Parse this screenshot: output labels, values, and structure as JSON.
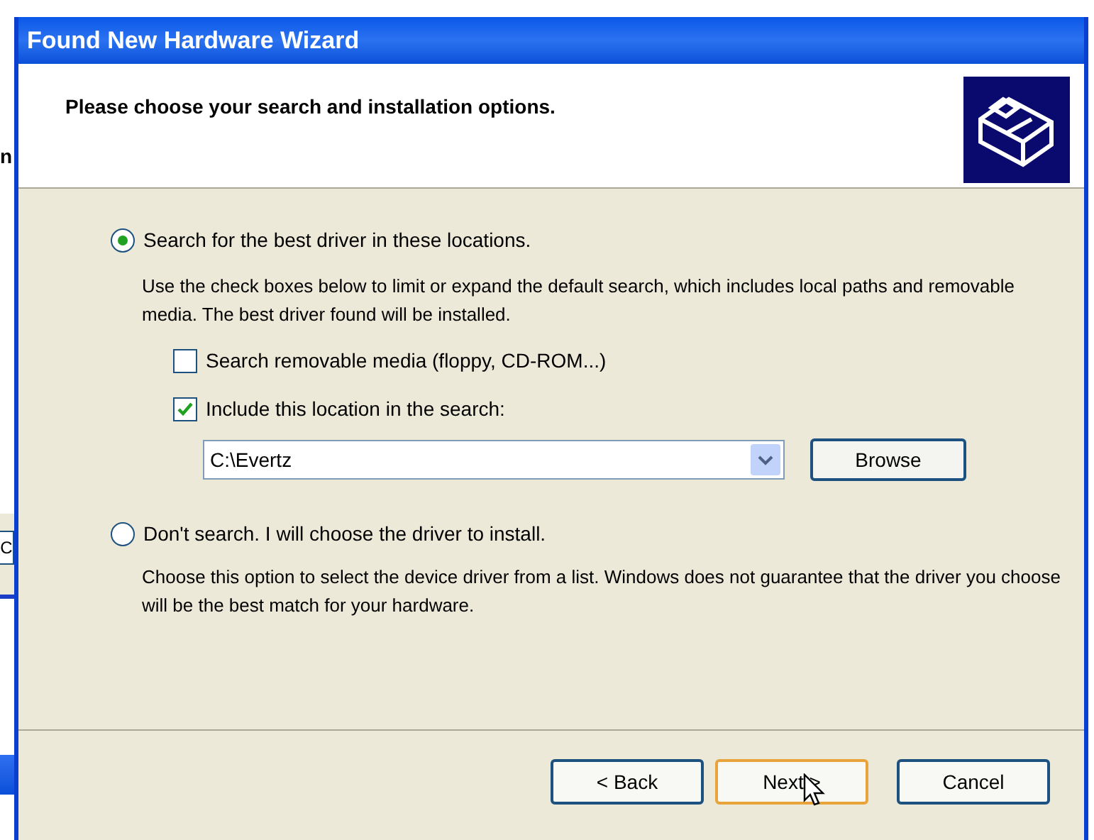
{
  "background": {
    "fragment_text": "n",
    "button_fragment": "C"
  },
  "window": {
    "title": "Found New Hardware Wizard"
  },
  "header": {
    "title": "Please choose your search and installation options."
  },
  "options": [
    {
      "label": "Search for the best driver in these locations.",
      "selected": true,
      "description": "Use the check boxes below to limit or expand the default search, which includes local paths and removable media. The best driver found will be installed."
    },
    {
      "label": "Don't search. I will choose the driver to install.",
      "selected": false,
      "description": "Choose this option to select the device driver from a list.  Windows does not guarantee that the driver you choose will be the best match for your hardware."
    }
  ],
  "checkboxes": [
    {
      "label": "Search removable media (floppy, CD-ROM...)",
      "checked": false
    },
    {
      "label": "Include this location in the search:",
      "checked": true
    }
  ],
  "location": {
    "value": "C:\\Evertz"
  },
  "browse_button": "Browse",
  "buttons": [
    {
      "label": "< Back",
      "default": false
    },
    {
      "label": "Next >",
      "default": true
    },
    {
      "label": "Cancel",
      "default": false
    }
  ]
}
